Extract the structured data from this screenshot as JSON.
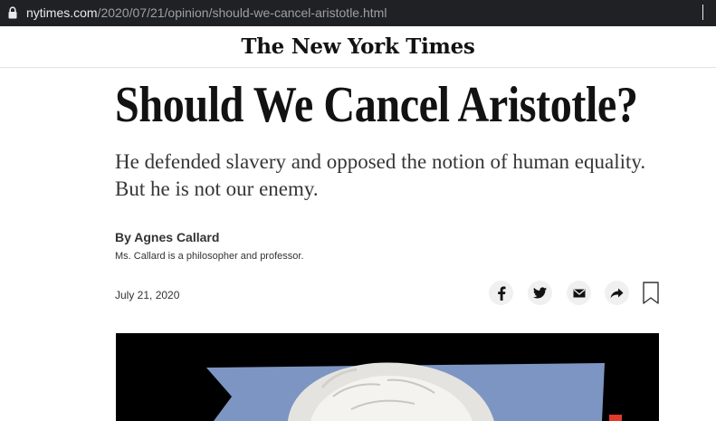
{
  "browser": {
    "url_domain": "nytimes.com",
    "url_path": "/2020/07/21/opinion/should-we-cancel-aristotle.html"
  },
  "site": {
    "logo": "The New York Times"
  },
  "article": {
    "headline": "Should We Cancel Aristotle?",
    "summary": "He defended slavery and opposed the notion of human equality. But he is not our enemy.",
    "byline": "By Agnes Callard",
    "author_bio": "Ms. Callard is a philosopher and professor.",
    "date": "July 21, 2020"
  },
  "share": {
    "icons": [
      "facebook-icon",
      "twitter-icon",
      "email-icon",
      "share-icon",
      "bookmark-icon"
    ]
  },
  "colors": {
    "address_bar_bg": "#202124",
    "text_dark": "#121212",
    "share_button_bg": "#f0f0f0",
    "image_backdrop_blue": "#7d95c2"
  }
}
